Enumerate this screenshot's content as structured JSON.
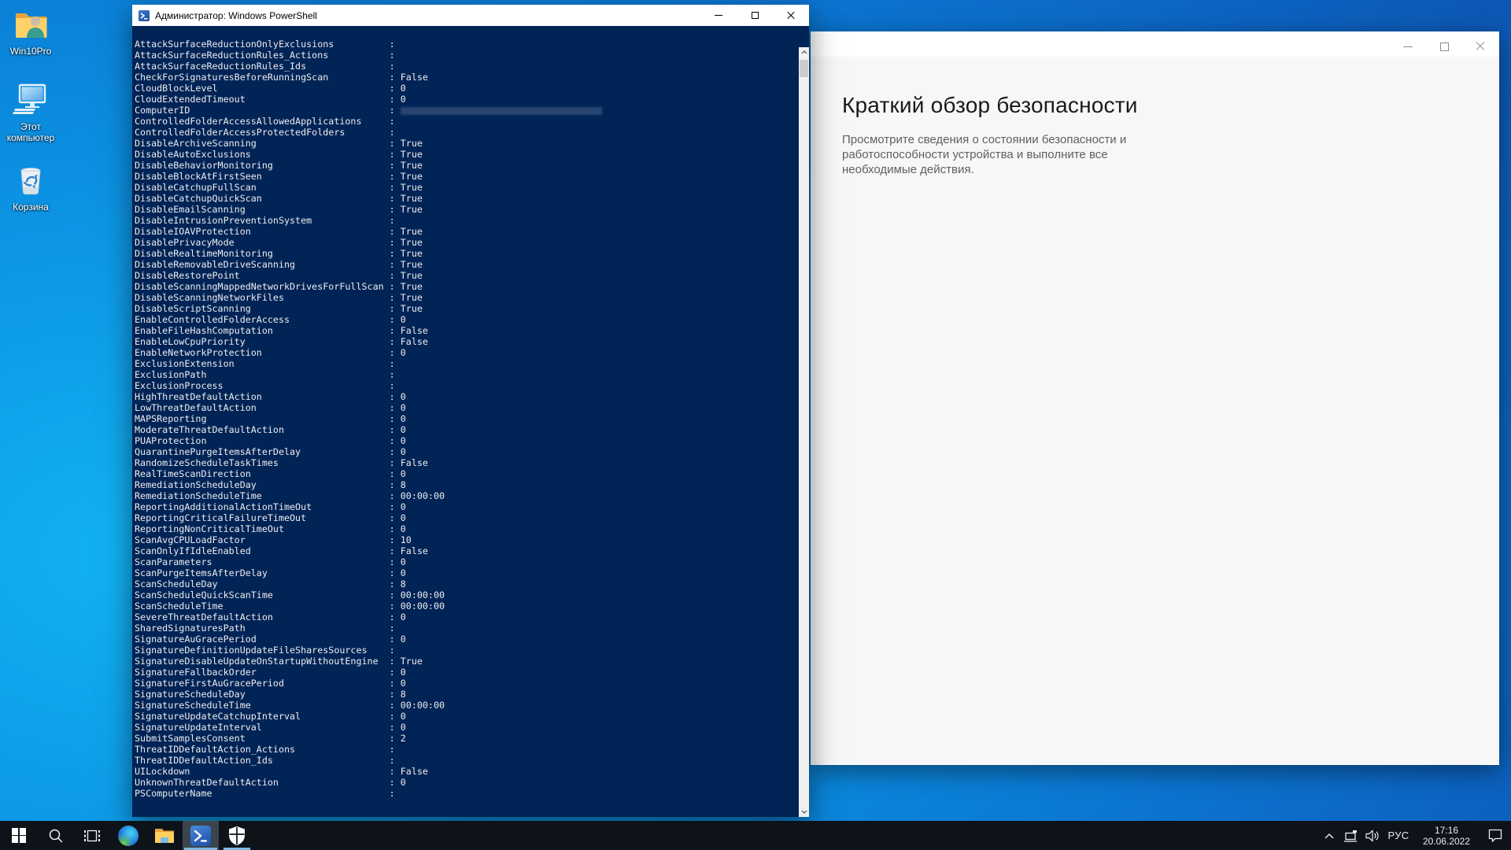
{
  "desktop": {
    "icons": [
      {
        "label": "Win10Pro"
      },
      {
        "label": "Этот компьютер"
      },
      {
        "label": "Корзина"
      }
    ],
    "background_color": "#0b8ee0"
  },
  "powershell_window": {
    "title": "Администратор: Windows PowerShell",
    "console_bg_color": "#012456",
    "text_color": "#eeedf0",
    "console_lines": [
      {
        "name": "AttackSurfaceReductionOnlyExclusions",
        "value": ""
      },
      {
        "name": "AttackSurfaceReductionRules_Actions",
        "value": ""
      },
      {
        "name": "AttackSurfaceReductionRules_Ids",
        "value": ""
      },
      {
        "name": "CheckForSignaturesBeforeRunningScan",
        "value": "False"
      },
      {
        "name": "CloudBlockLevel",
        "value": "0"
      },
      {
        "name": "CloudExtendedTimeout",
        "value": "0"
      },
      {
        "name": "ComputerID",
        "value": "",
        "redacted": true
      },
      {
        "name": "ControlledFolderAccessAllowedApplications",
        "value": ""
      },
      {
        "name": "ControlledFolderAccessProtectedFolders",
        "value": ""
      },
      {
        "name": "DisableArchiveScanning",
        "value": "True"
      },
      {
        "name": "DisableAutoExclusions",
        "value": "True"
      },
      {
        "name": "DisableBehaviorMonitoring",
        "value": "True"
      },
      {
        "name": "DisableBlockAtFirstSeen",
        "value": "True"
      },
      {
        "name": "DisableCatchupFullScan",
        "value": "True"
      },
      {
        "name": "DisableCatchupQuickScan",
        "value": "True"
      },
      {
        "name": "DisableEmailScanning",
        "value": "True"
      },
      {
        "name": "DisableIntrusionPreventionSystem",
        "value": ""
      },
      {
        "name": "DisableIOAVProtection",
        "value": "True"
      },
      {
        "name": "DisablePrivacyMode",
        "value": "True"
      },
      {
        "name": "DisableRealtimeMonitoring",
        "value": "True"
      },
      {
        "name": "DisableRemovableDriveScanning",
        "value": "True"
      },
      {
        "name": "DisableRestorePoint",
        "value": "True"
      },
      {
        "name": "DisableScanningMappedNetworkDrivesForFullScan",
        "value": "True"
      },
      {
        "name": "DisableScanningNetworkFiles",
        "value": "True"
      },
      {
        "name": "DisableScriptScanning",
        "value": "True"
      },
      {
        "name": "EnableControlledFolderAccess",
        "value": "0"
      },
      {
        "name": "EnableFileHashComputation",
        "value": "False"
      },
      {
        "name": "EnableLowCpuPriority",
        "value": "False"
      },
      {
        "name": "EnableNetworkProtection",
        "value": "0"
      },
      {
        "name": "ExclusionExtension",
        "value": ""
      },
      {
        "name": "ExclusionPath",
        "value": ""
      },
      {
        "name": "ExclusionProcess",
        "value": ""
      },
      {
        "name": "HighThreatDefaultAction",
        "value": "0"
      },
      {
        "name": "LowThreatDefaultAction",
        "value": "0"
      },
      {
        "name": "MAPSReporting",
        "value": "0"
      },
      {
        "name": "ModerateThreatDefaultAction",
        "value": "0"
      },
      {
        "name": "PUAProtection",
        "value": "0"
      },
      {
        "name": "QuarantinePurgeItemsAfterDelay",
        "value": "0"
      },
      {
        "name": "RandomizeScheduleTaskTimes",
        "value": "False"
      },
      {
        "name": "RealTimeScanDirection",
        "value": "0"
      },
      {
        "name": "RemediationScheduleDay",
        "value": "8"
      },
      {
        "name": "RemediationScheduleTime",
        "value": "00:00:00"
      },
      {
        "name": "ReportingAdditionalActionTimeOut",
        "value": "0"
      },
      {
        "name": "ReportingCriticalFailureTimeOut",
        "value": "0"
      },
      {
        "name": "ReportingNonCriticalTimeOut",
        "value": "0"
      },
      {
        "name": "ScanAvgCPULoadFactor",
        "value": "10"
      },
      {
        "name": "ScanOnlyIfIdleEnabled",
        "value": "False"
      },
      {
        "name": "ScanParameters",
        "value": "0"
      },
      {
        "name": "ScanPurgeItemsAfterDelay",
        "value": "0"
      },
      {
        "name": "ScanScheduleDay",
        "value": "8"
      },
      {
        "name": "ScanScheduleQuickScanTime",
        "value": "00:00:00"
      },
      {
        "name": "ScanScheduleTime",
        "value": "00:00:00"
      },
      {
        "name": "SevereThreatDefaultAction",
        "value": "0"
      },
      {
        "name": "SharedSignaturesPath",
        "value": ""
      },
      {
        "name": "SignatureAuGracePeriod",
        "value": "0"
      },
      {
        "name": "SignatureDefinitionUpdateFileSharesSources",
        "value": ""
      },
      {
        "name": "SignatureDisableUpdateOnStartupWithoutEngine",
        "value": "True"
      },
      {
        "name": "SignatureFallbackOrder",
        "value": "0"
      },
      {
        "name": "SignatureFirstAuGracePeriod",
        "value": "0"
      },
      {
        "name": "SignatureScheduleDay",
        "value": "8"
      },
      {
        "name": "SignatureScheduleTime",
        "value": "00:00:00"
      },
      {
        "name": "SignatureUpdateCatchupInterval",
        "value": "0"
      },
      {
        "name": "SignatureUpdateInterval",
        "value": "0"
      },
      {
        "name": "SubmitSamplesConsent",
        "value": "2"
      },
      {
        "name": "ThreatIDDefaultAction_Actions",
        "value": ""
      },
      {
        "name": "ThreatIDDefaultAction_Ids",
        "value": ""
      },
      {
        "name": "UILockdown",
        "value": "False"
      },
      {
        "name": "UnknownThreatDefaultAction",
        "value": "0"
      },
      {
        "name": "PSComputerName",
        "value": ""
      }
    ]
  },
  "security_window": {
    "heading": "Краткий обзор безопасности",
    "description": "Просмотрите сведения о состоянии безопасности и работоспособности устройства и выполните все необходимые действия."
  },
  "taskbar": {
    "bg_color": "#0e131a",
    "active_highlight_color": "#3a454e",
    "underline_color": "#7fb9e1",
    "items": [
      "start",
      "search",
      "task-view",
      "edge",
      "file-explorer",
      "powershell",
      "windows-security"
    ],
    "tray": {
      "language": "РУС",
      "time": "17:16",
      "date": "20.06.2022"
    }
  }
}
